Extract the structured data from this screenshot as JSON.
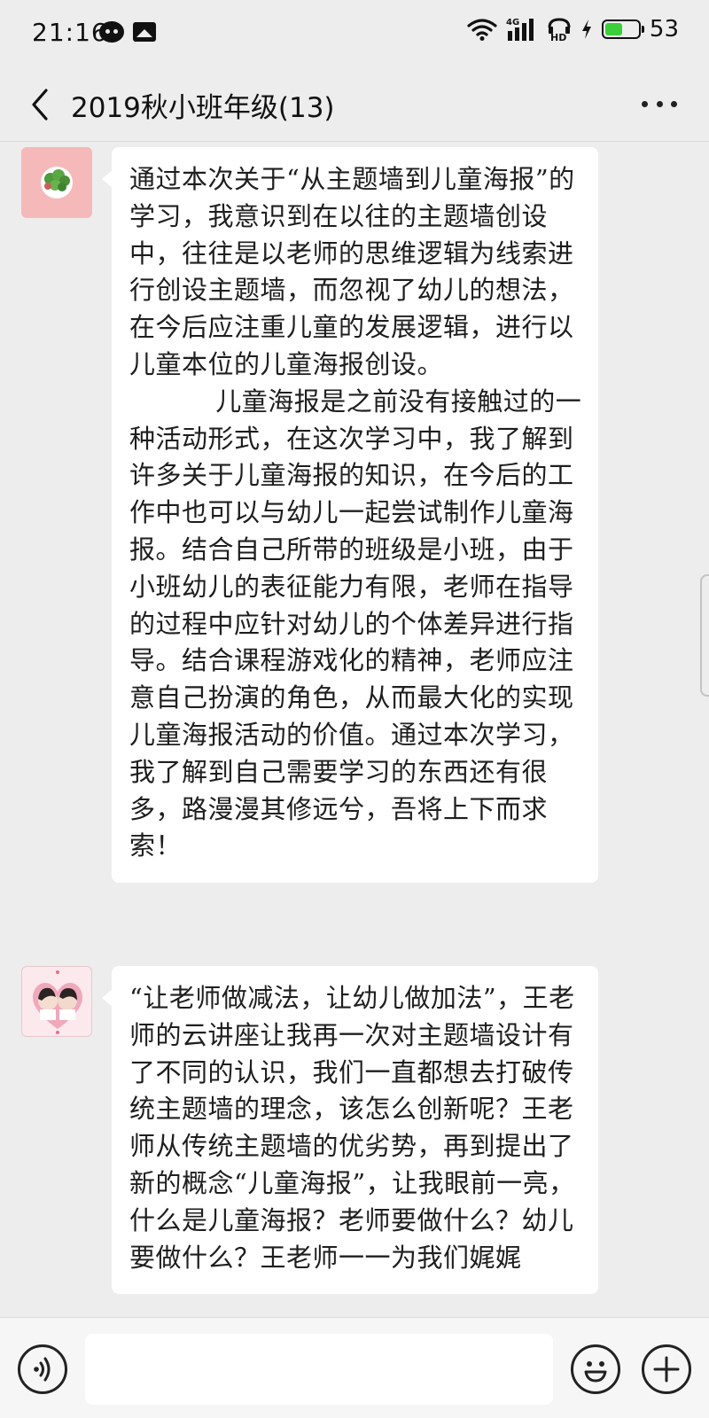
{
  "status_bar": {
    "time": "21:16",
    "network": "4G",
    "hd_label": "HD",
    "battery_percent": "53",
    "battery_level": 0.53,
    "battery_color": "#3ccf3c",
    "icons": [
      "wechat-icon",
      "photo-icon",
      "wifi-icon",
      "signal-icon",
      "hd-icon",
      "charging-icon",
      "battery-icon"
    ]
  },
  "nav": {
    "title": "2019秋小班年级(13)",
    "back_icon": "chevron-left-icon",
    "more_icon": "more-dots-icon"
  },
  "messages": [
    {
      "avatar": "avatar-broccoli",
      "text": "通过本次关于“从主题墙到儿童海报”的学习，我意识到在以往的主题墙创设中，往往是以老师的思维逻辑为线索进行创设主题墙，而忽视了幼儿的想法，在今后应注重儿童的发展逻辑，进行以儿童本位的儿童海报创设。\n          儿童海报是之前没有接触过的一种活动形式，在这次学习中，我了解到许多关于儿童海报的知识，在今后的工作中也可以与幼儿一起尝试制作儿童海报。结合自己所带的班级是小班，由于小班幼儿的表征能力有限，老师在指导的过程中应针对幼儿的个体差异进行指导。结合课程游戏化的精神，老师应注意自己扮演的角色，从而最大化的实现儿童海报活动的价值。通过本次学习，我了解到自己需要学习的东西还有很多，路漫漫其修远兮，吾将上下而求索！"
    },
    {
      "avatar": "avatar-photo-heart",
      "text": "“让老师做减法，让幼儿做加法”，王老师的云讲座让我再一次对主题墙设计有了不同的认识，我们一直都想去打破传统主题墙的理念，该怎么创新呢？王老师从传统主题墙的优劣势，再到提出了新的概念“儿童海报”，让我眼前一亮，什么是儿童海报？老师要做什么？幼儿要做什么？王老师一一为我们娓娓"
    }
  ],
  "input_bar": {
    "voice_icon": "voice-icon",
    "input_placeholder": "",
    "emoji_icon": "emoji-icon",
    "plus_icon": "plus-icon"
  }
}
